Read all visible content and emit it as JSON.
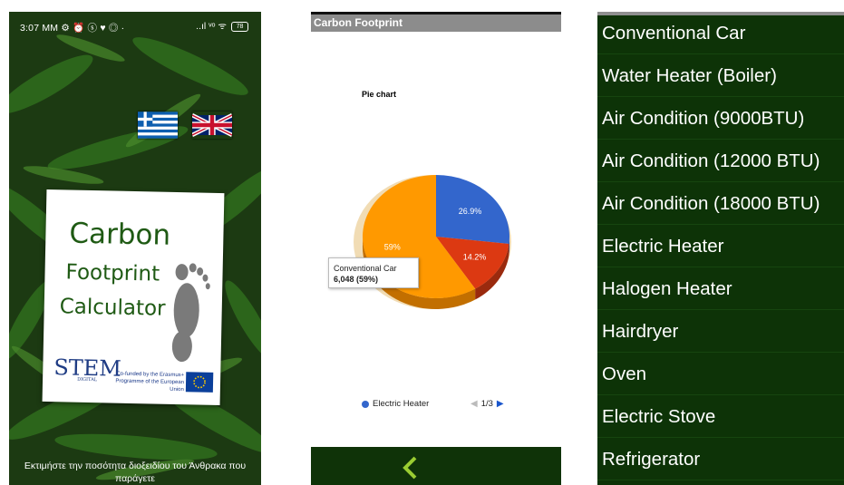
{
  "screen1": {
    "status_time": "3:07 MM",
    "status_icons_left": "⚙ ⏰ ⓢ ♥ ◎ ·",
    "status_icons_right": "..ıl ᵛᵒ ᯤ",
    "battery": "78",
    "flags": [
      "greece-flag",
      "uk-flag"
    ],
    "title_line1": "Carbon",
    "title_line2": "Footprint",
    "title_line3": "Calculator",
    "logo_text": "STEM",
    "logo_sub": "DIGITAL",
    "cofunded": "Co-funded by the Erasmus+ Programme of the European Union",
    "bottom_text": "Εκτιμήστε την ποσότητα διοξειδίου του Άνθρακα που παράγετε"
  },
  "screen2": {
    "app_title": "Carbon Footprint",
    "chart_title": "Pie chart",
    "tooltip_label": "Conventional Car",
    "tooltip_value": "6,048 (59%)",
    "legend_label": "Electric Heater",
    "pager_text": "1/3",
    "colors": {
      "blue": "#3366cc",
      "red": "#dc3912",
      "orange": "#ff9900"
    }
  },
  "chart_data": {
    "type": "pie",
    "title": "Pie chart",
    "slices": [
      {
        "label": "26.9%",
        "value": 26.9,
        "color": "#3366cc"
      },
      {
        "label": "14.2%",
        "value": 14.2,
        "color": "#dc3912"
      },
      {
        "label": "59%",
        "value": 59,
        "color": "#ff9900",
        "name": "Conventional Car",
        "raw": "6,048"
      }
    ],
    "legend": [
      "Electric Heater"
    ]
  },
  "screen3": {
    "items": [
      "Conventional Car",
      "Water Heater (Boiler)",
      "Air Condition (9000BTU)",
      "Air Condition (12000 BTU)",
      "Air Condition (18000 BTU)",
      "Electric Heater",
      "Halogen Heater",
      "Hairdryer",
      "Oven",
      "Electric Stove",
      "Refrigerator"
    ]
  }
}
